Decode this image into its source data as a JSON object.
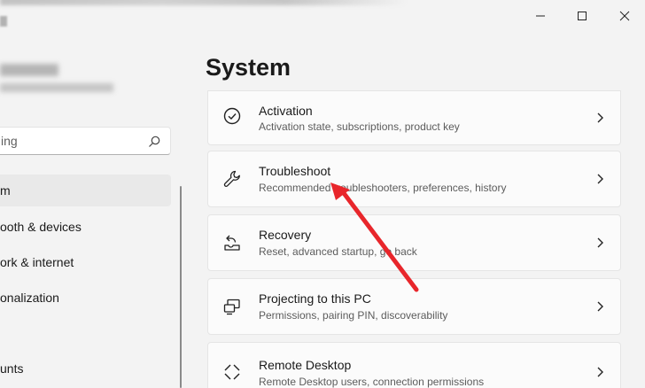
{
  "window": {
    "controls": {
      "minimize_icon": "minimize-icon",
      "maximize_icon": "maximize-icon",
      "close_icon": "close-icon"
    }
  },
  "sidebar": {
    "search": {
      "placeholder": "ing"
    },
    "items": [
      {
        "label": "m",
        "active": true
      },
      {
        "label": "ooth & devices",
        "active": false
      },
      {
        "label": "ork & internet",
        "active": false
      },
      {
        "label": "onalization",
        "active": false
      },
      {
        "label": "unts",
        "active": false
      }
    ]
  },
  "main": {
    "title": "System",
    "cards": [
      {
        "icon": "activation-check-icon",
        "title": "Activation",
        "description": "Activation state, subscriptions, product key"
      },
      {
        "icon": "wrench-icon",
        "title": "Troubleshoot",
        "description": "Recommended troubleshooters, preferences, history"
      },
      {
        "icon": "recovery-icon",
        "title": "Recovery",
        "description": "Reset, advanced startup, go back"
      },
      {
        "icon": "projector-icon",
        "title": "Projecting to this PC",
        "description": "Permissions, pairing PIN, discoverability"
      },
      {
        "icon": "remote-desktop-icon",
        "title": "Remote Desktop",
        "description": "Remote Desktop users, connection permissions"
      }
    ]
  },
  "annotation": {
    "color": "#e8262b"
  }
}
